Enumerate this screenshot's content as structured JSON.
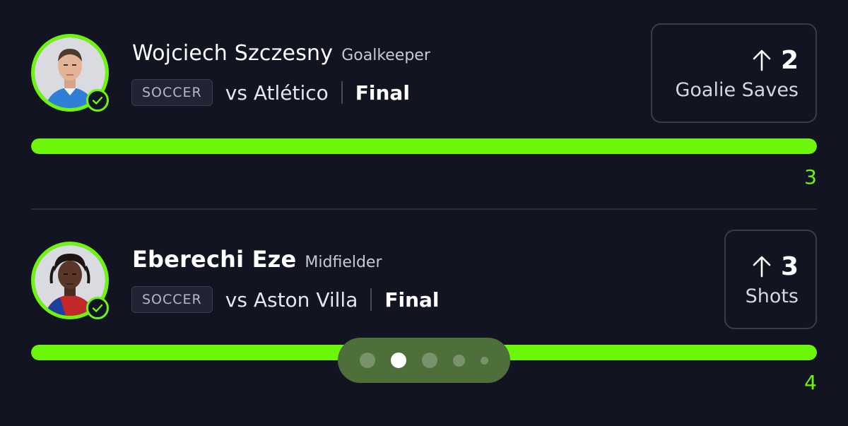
{
  "props": [
    {
      "player": "Wojciech Szczesny",
      "position": "Goalkeeper",
      "sport": "SOCCER",
      "opponent": "vs Atlético",
      "status": "Final",
      "direction_icon": "arrow-up-icon",
      "line": "2",
      "stat": "Goalie Saves",
      "actual": "3",
      "progress_fraction": 1.0,
      "avatar_icon": "player-photo"
    },
    {
      "player": "Eberechi Eze",
      "position": "Midfielder",
      "sport": "SOCCER",
      "opponent": "vs Aston Villa",
      "status": "Final",
      "direction_icon": "arrow-up-icon",
      "line": "3",
      "stat": "Shots",
      "actual": "4",
      "progress_fraction": 1.0,
      "avatar_icon": "player-photo"
    }
  ],
  "pager": {
    "count": 5,
    "active_index": 1
  },
  "colors": {
    "background": "#131422",
    "accent_green": "#6cf70a",
    "pager_bg": "#4e6e3a"
  }
}
